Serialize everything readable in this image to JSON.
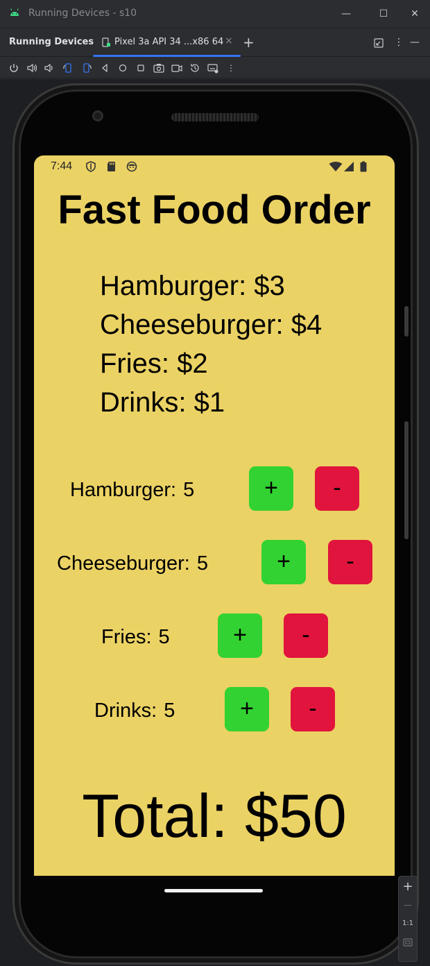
{
  "window": {
    "title": "Running Devices - s10",
    "controls": {
      "minimize": "—",
      "maximize": "☐",
      "close": "✕"
    }
  },
  "tabs": {
    "panel_title": "Running Devices",
    "active_tab_label": "Pixel 3a API 34 ...x86 64",
    "close": "×",
    "add": "+",
    "options": "⋮",
    "hide": "—"
  },
  "toolbar": {
    "more": "⋮"
  },
  "device": {
    "status_time": "7:44"
  },
  "app": {
    "title": "Fast Food Order",
    "menu": [
      "Hamburger: $3",
      "Cheeseburger: $4",
      "Fries: $2",
      "Drinks: $1"
    ],
    "items": [
      {
        "name": "Hamburger:",
        "qty": "5",
        "plus": "+",
        "minus": "-"
      },
      {
        "name": "Cheeseburger:",
        "qty": "5",
        "plus": "+",
        "minus": "-"
      },
      {
        "name": "Fries:",
        "qty": "5",
        "plus": "+",
        "minus": "-"
      },
      {
        "name": "Drinks:",
        "qty": "5",
        "plus": "+",
        "minus": "-"
      }
    ],
    "total": "Total: $50",
    "colors": {
      "background": "#ebd264",
      "plus": "#32d232",
      "minus": "#e0143c"
    }
  },
  "zoom": {
    "in": "+",
    "out": "—",
    "actual": "1:1"
  }
}
